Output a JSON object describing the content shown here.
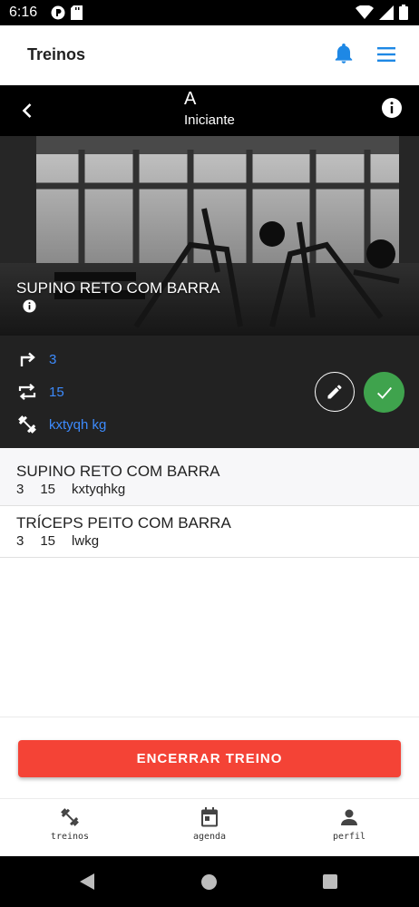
{
  "status_bar": {
    "time": "6:16",
    "icons": [
      "app-notification-icon",
      "sd-card-icon",
      "wifi-icon",
      "signal-icon",
      "battery-icon"
    ]
  },
  "app_bar": {
    "title": "Treinos",
    "icons": [
      "bell-icon",
      "menu-icon"
    ],
    "accent_color": "#1e88e5"
  },
  "workout_header": {
    "title": "A",
    "subtitle": "Iniciante",
    "icons": [
      "back-arrow-icon",
      "info-icon"
    ]
  },
  "current_exercise": {
    "name": "SUPINO RETO COM BARRA",
    "series": "3",
    "reps": "15",
    "load": "kxtyqh kg",
    "value_color": "#3d8bfd",
    "done_color": "#3fa34d"
  },
  "exercise_list": [
    {
      "name": "SUPINO RETO COM BARRA",
      "series": "3",
      "reps": "15",
      "load": "kxtyqhkg"
    },
    {
      "name": "TRÍCEPS PEITO COM BARRA",
      "series": "3",
      "reps": "15",
      "load": "lwkg"
    }
  ],
  "end_button": {
    "label": "ENCERRAR TREINO",
    "color": "#f44336"
  },
  "bottom_nav": {
    "items": [
      {
        "label": "treinos",
        "icon": "dumbbell-icon"
      },
      {
        "label": "agenda",
        "icon": "calendar-icon"
      },
      {
        "label": "perfil",
        "icon": "person-icon"
      }
    ]
  }
}
